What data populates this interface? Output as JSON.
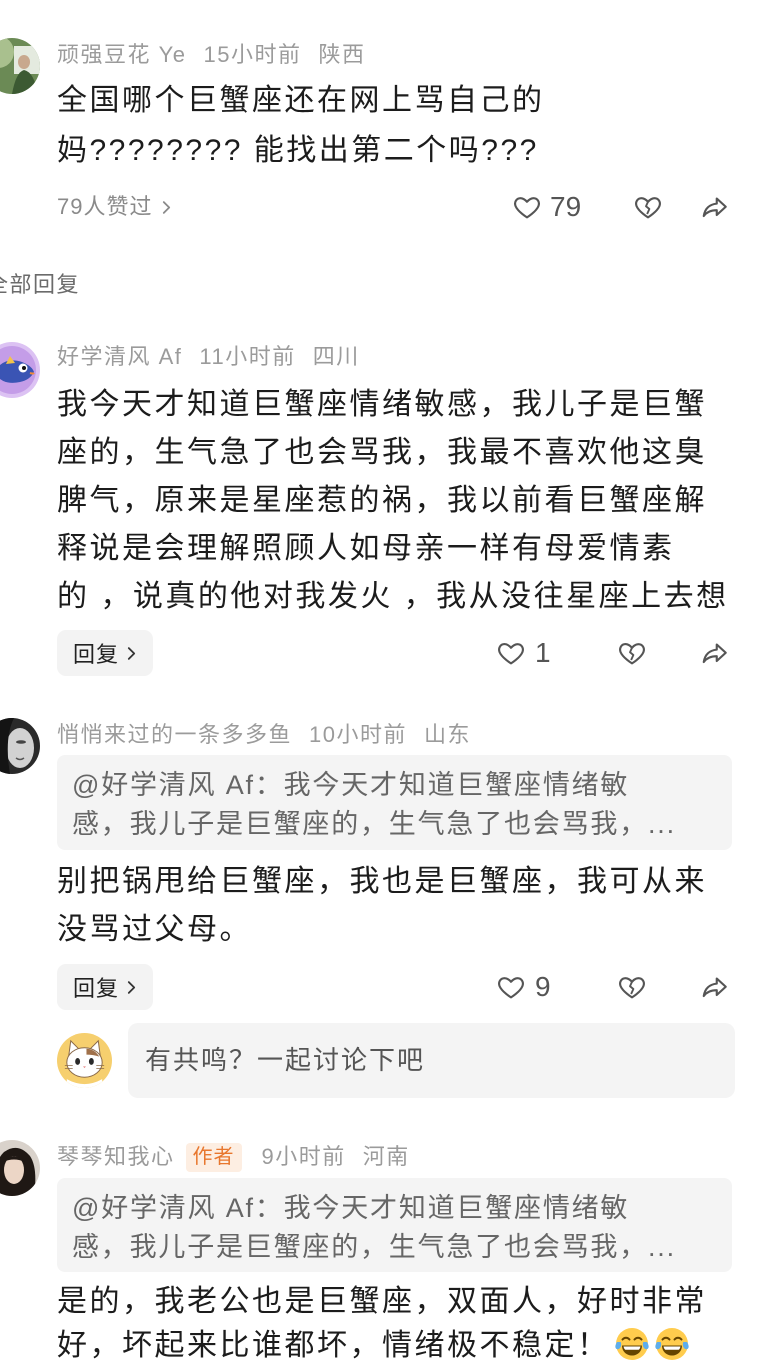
{
  "top_comment": {
    "author": "顽强豆花 Ye",
    "time": "15小时前",
    "location": "陕西",
    "text_lines": [
      "全国哪个巨蟹座还在网上骂自己的",
      "妈???????? 能找出第二个吗???"
    ],
    "likes_summary": "79人赞过",
    "like_count": "79"
  },
  "section_title": "全部回复",
  "replies": [
    {
      "author": "好学清风 Af",
      "time": "11小时前",
      "location": "四川",
      "text_lines": [
        "我今天才知道巨蟹座情绪敏感，我儿子是巨蟹",
        "座的，生气急了也会骂我，我最不喜欢他这臭",
        "脾气，原来是星座惹的祸，我以前看巨蟹座解",
        "释说是会理解照顾人如母亲一样有母爱情素",
        "的 ，说真的他对我发火 ，我从没往星座上去想"
      ],
      "reply_label": "回复",
      "like_count": "1"
    },
    {
      "author": "悄悄来过的一条多多鱼",
      "time": "10小时前",
      "location": "山东",
      "quote_lines": [
        "@好学清风 Af：我今天才知道巨蟹座情绪敏",
        "感，我儿子是巨蟹座的，生气急了也会骂我，..."
      ],
      "text_lines": [
        "别把锅甩给巨蟹座，我也是巨蟹座，我可从来",
        "没骂过父母。"
      ],
      "reply_label": "回复",
      "like_count": "9"
    },
    {
      "author": "琴琴知我心",
      "badge": "作者",
      "time": "9小时前",
      "location": "河南",
      "quote_lines": [
        "@好学清风 Af：我今天才知道巨蟹座情绪敏",
        "感，我儿子是巨蟹座的，生气急了也会骂我，..."
      ],
      "text_lines": [
        "是的，我老公也是巨蟹座，双面人，好时非常",
        "好，坏起来比谁都坏，情绪极不稳定！"
      ],
      "emojis": [
        "face-with-tears-of-joy",
        "face-with-tears-of-joy"
      ]
    }
  ],
  "composer": {
    "placeholder": "有共鸣？一起讨论下吧"
  },
  "icons": {
    "like": "heart-outline-icon",
    "dislike": "broken-heart-icon",
    "share": "share-arrow-icon",
    "expand": "chevron-right-icon"
  },
  "colors": {
    "text": "#1c1c1c",
    "meta": "#9b9b9b",
    "author_badge_text": "#e8772e",
    "author_badge_bg": "#fdeee2",
    "chip_bg": "#f3f3f3",
    "quote_bg": "#f4f4f4"
  }
}
